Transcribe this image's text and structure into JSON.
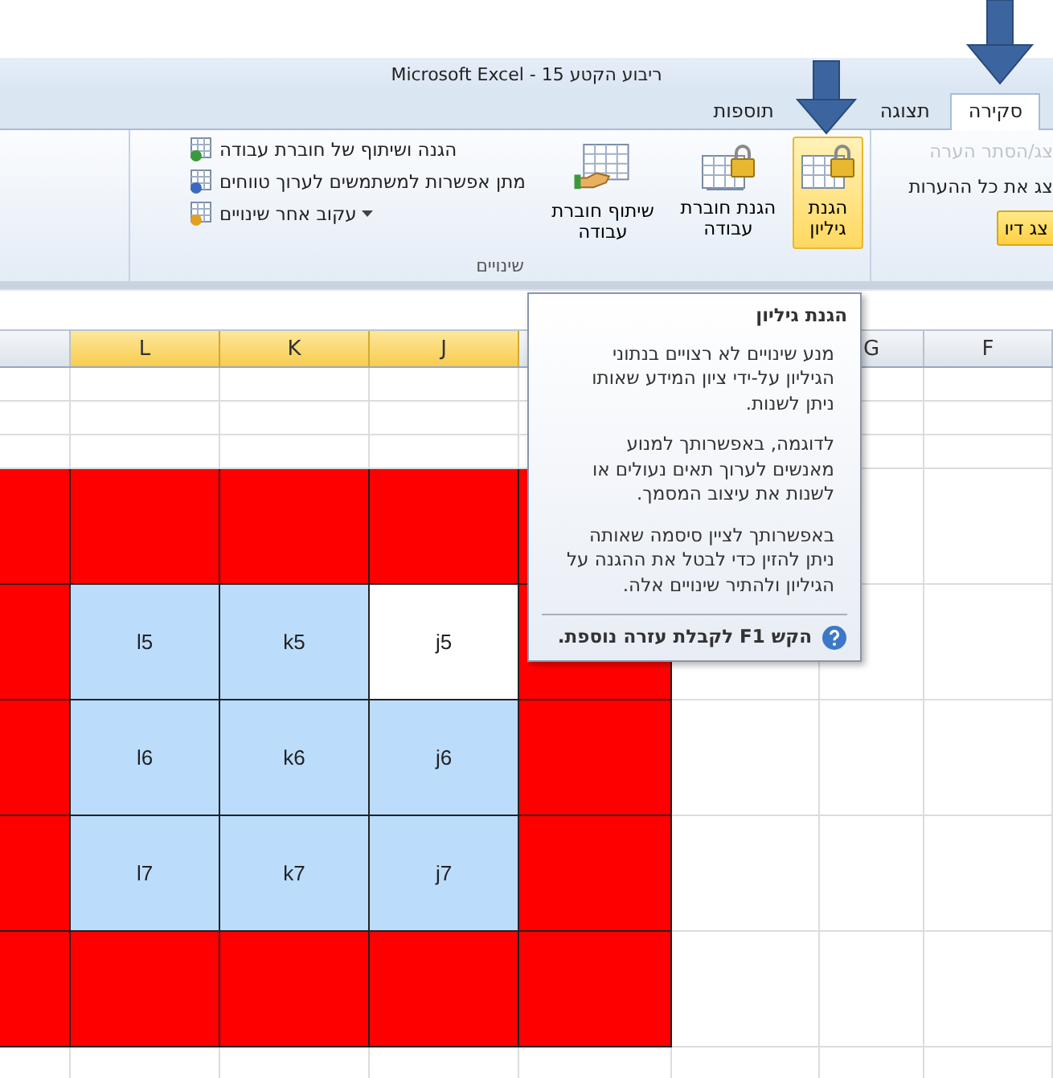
{
  "window": {
    "title": "ריבוע הקטע 15 - Microsoft Excel"
  },
  "tabs": [
    {
      "label": "סקירה",
      "selected": true
    },
    {
      "label": "תצוגה",
      "selected": false
    },
    {
      "label": "תוספות",
      "selected": false
    }
  ],
  "ribbon": {
    "groups": [
      {
        "items": [
          {
            "kind": "small",
            "label": "צג/הסתר הערה",
            "disabled": true
          },
          {
            "kind": "small",
            "label": "צג את כל ההערות",
            "disabled": false
          },
          {
            "kind": "ink",
            "label": "צג דיו"
          }
        ]
      },
      {
        "label": "שינויים",
        "large": [
          {
            "label": "הגנת גיליון",
            "selected": true
          },
          {
            "label": "הגנת חוברת עבודה",
            "selected": false
          },
          {
            "label": "שיתוף חוברת עבודה",
            "selected": false
          }
        ],
        "small": [
          {
            "label": "הגנה ושיתוף של חוברת עבודה",
            "dropdown": false
          },
          {
            "label": "מתן אפשרות למשתמשים לערוך טווחים",
            "dropdown": false
          },
          {
            "label": "עקוב אחר שינויים",
            "dropdown": true
          }
        ]
      }
    ]
  },
  "sheet": {
    "columns": [
      {
        "label": "F",
        "selected": false
      },
      {
        "label": "G",
        "selected": false
      },
      {},
      {
        "selected": false
      },
      {
        "label": "J",
        "selected": true
      },
      {
        "label": "K",
        "selected": true
      },
      {
        "label": "L",
        "selected": true
      },
      {
        "selected": false
      }
    ],
    "rows": [
      {
        "cells": [
          {},
          {},
          {},
          {
            "color": "#ff0000"
          },
          {
            "color": "#ff0000"
          },
          {
            "color": "#ff0000"
          },
          {
            "color": "#ff0000"
          },
          {
            "color": "#ff0000"
          }
        ]
      },
      {
        "cells": [
          {},
          {},
          {},
          {
            "color": "#ff0000"
          },
          {
            "text": "j5",
            "color": "#ffffff"
          },
          {
            "text": "k5",
            "color": "#bcdcfc"
          },
          {
            "text": "l5",
            "color": "#bcdcfc"
          },
          {
            "color": "#ff0000"
          }
        ]
      },
      {
        "cells": [
          {},
          {},
          {},
          {
            "color": "#ff0000"
          },
          {
            "text": "j6",
            "color": "#bcdcfc"
          },
          {
            "text": "k6",
            "color": "#bcdcfc"
          },
          {
            "text": "l6",
            "color": "#bcdcfc"
          },
          {
            "color": "#ff0000"
          }
        ]
      },
      {
        "cells": [
          {},
          {},
          {},
          {
            "color": "#ff0000"
          },
          {
            "text": "j7",
            "color": "#bcdcfc"
          },
          {
            "text": "k7",
            "color": "#bcdcfc"
          },
          {
            "text": "l7",
            "color": "#bcdcfc"
          },
          {
            "color": "#ff0000"
          }
        ]
      },
      {
        "cells": [
          {},
          {},
          {},
          {
            "color": "#ff0000"
          },
          {
            "color": "#ff0000"
          },
          {
            "color": "#ff0000"
          },
          {
            "color": "#ff0000"
          },
          {
            "color": "#ff0000"
          }
        ]
      }
    ]
  },
  "tooltip": {
    "title": "הגנת גיליון",
    "paragraphs": [
      "מנע שינויים לא רצויים בנתוני הגיליון על-ידי ציון המידע שאותו ניתן לשנות.",
      "לדוגמה, באפשרותך למנוע מאנשים לערוך תאים נעולים או לשנות את עיצוב המסמך.",
      "באפשרותך לציין סיסמה שאותה ניתן להזין כדי לבטל את ההגנה על הגיליון ולהתיר שינויים אלה."
    ],
    "footer": "הקש F1 לקבלת עזרה נוספת."
  }
}
